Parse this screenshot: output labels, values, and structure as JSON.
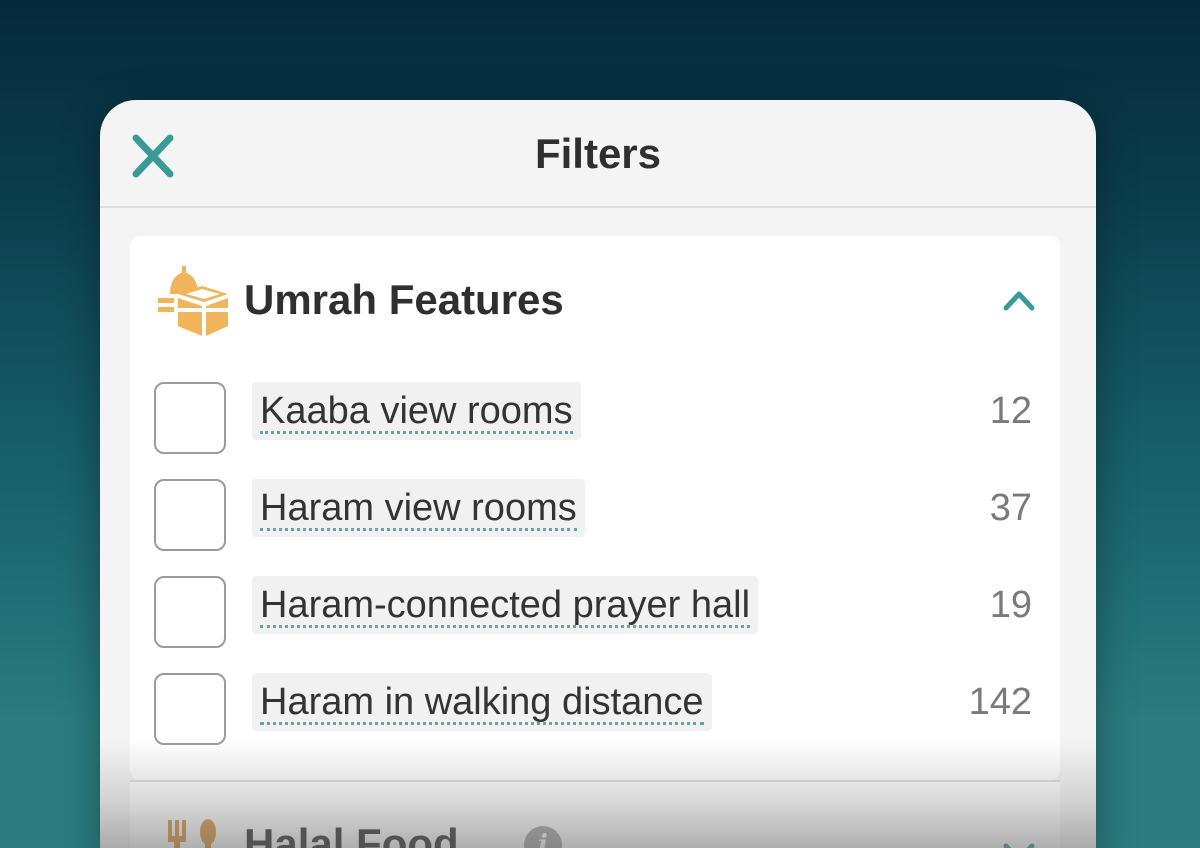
{
  "header": {
    "title": "Filters",
    "close_icon": "close-icon",
    "accent_color": "#3a9b96"
  },
  "umrah_section": {
    "title": "Umrah Features",
    "icon": "kaaba-icon",
    "icon_color": "#f0b45a",
    "expanded": true,
    "items": [
      {
        "label": "Kaaba view rooms",
        "count": "12",
        "checked": false
      },
      {
        "label": "Haram view rooms",
        "count": "37",
        "checked": false
      },
      {
        "label": "Haram-connected prayer hall",
        "count": "19",
        "checked": false
      },
      {
        "label": "Haram in walking distance",
        "count": "142",
        "checked": false
      }
    ]
  },
  "halal_section": {
    "title": "Halal Food",
    "icon": "cutlery-icon",
    "info_label": "i",
    "expanded": false
  }
}
